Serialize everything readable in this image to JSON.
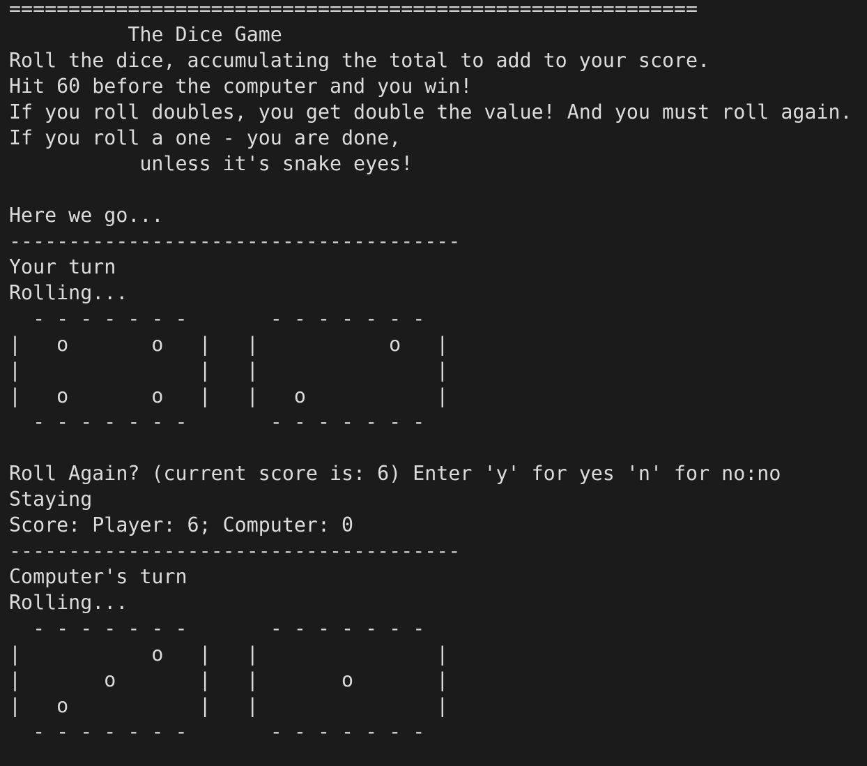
{
  "terminal": {
    "top_rule": "==========================================================",
    "lines": [
      "          The Dice Game",
      "Roll the dice, accumulating the total to add to your score.",
      "Hit 60 before the computer and you win!",
      "If you roll doubles, you get double the value! And you must roll again.",
      "If you roll a one - you are done,",
      "           unless it's snake eyes!",
      "",
      "Here we go...",
      "--------------------------------------",
      "Your turn",
      "Rolling...",
      "  - - - - - - -       - - - - - - -",
      "|   o       o   |   |           o   |",
      "|               |   |               |",
      "|   o       o   |   |   o           |",
      "  - - - - - - -       - - - - - - -",
      "",
      "Roll Again? (current score is: 6) Enter 'y' for yes 'n' for no:no",
      "Staying",
      "Score: Player: 6; Computer: 0",
      "--------------------------------------",
      "Computer's turn",
      "Rolling...",
      "  - - - - - - -       - - - - - - -",
      "|           o   |   |               |",
      "|       o       |   |       o       |",
      "|   o           |   |               |",
      "  - - - - - - -       - - - - - - -"
    ]
  }
}
